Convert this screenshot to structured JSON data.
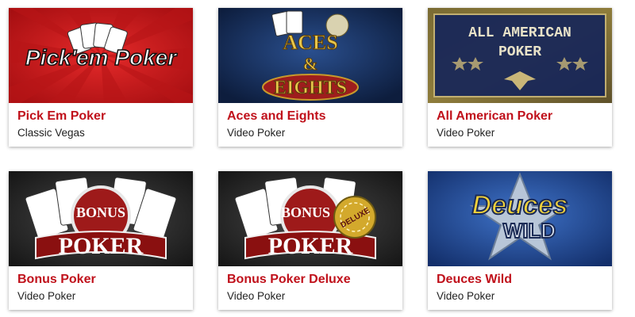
{
  "games": [
    {
      "title": "Pick Em Poker",
      "subtitle": "Classic Vegas",
      "logo_text": "Pick'em Poker",
      "theme": "red"
    },
    {
      "title": "Aces and Eights",
      "subtitle": "Video Poker",
      "logo_text": [
        "ACES",
        "&",
        "EIGHTS"
      ],
      "theme": "navy"
    },
    {
      "title": "All American Poker",
      "subtitle": "Video Poker",
      "logo_text": [
        "ALL AMERICAN",
        "POKER"
      ],
      "theme": "olive"
    },
    {
      "title": "Bonus Poker",
      "subtitle": "Video Poker",
      "logo_text": [
        "BONUS",
        "POKER"
      ],
      "theme": "dark"
    },
    {
      "title": "Bonus Poker Deluxe",
      "subtitle": "Video Poker",
      "logo_text": [
        "BONUS",
        "POKER",
        "DELUXE"
      ],
      "theme": "dark"
    },
    {
      "title": "Deuces Wild",
      "subtitle": "Video Poker",
      "logo_text": [
        "Deuces",
        "WILD"
      ],
      "theme": "blue"
    }
  ],
  "colors": {
    "title_red": "#c0111b",
    "subtitle": "#222222"
  }
}
